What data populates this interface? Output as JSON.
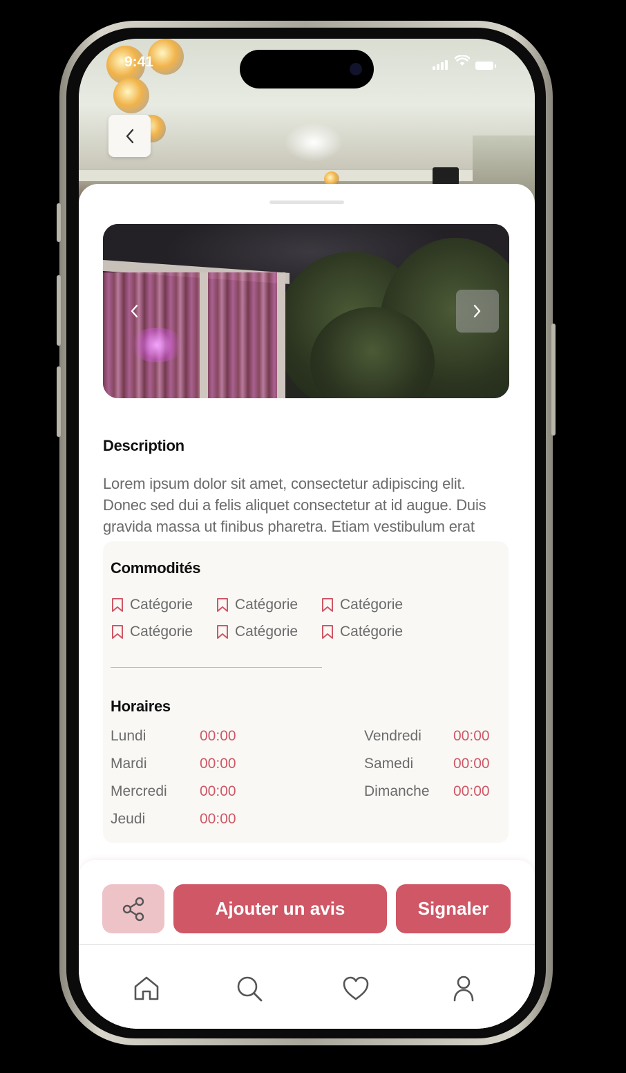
{
  "status_bar": {
    "time": "9:41"
  },
  "description": {
    "title": "Description",
    "text": "Lorem ipsum dolor sit amet, consectetur adipiscing elit. Donec sed dui a felis aliquet consectetur at id augue. Duis gravida massa ut finibus pharetra. Etiam vestibulum erat"
  },
  "amenities": {
    "title": "Commodités",
    "items": [
      "Catégorie",
      "Catégorie",
      "Catégorie",
      "Catégorie",
      "Catégorie",
      "Catégorie"
    ]
  },
  "hours": {
    "title": "Horaires",
    "left": [
      {
        "day": "Lundi",
        "time": "00:00"
      },
      {
        "day": "Mardi",
        "time": "00:00"
      },
      {
        "day": "Mercredi",
        "time": "00:00"
      },
      {
        "day": "Jeudi",
        "time": "00:00"
      }
    ],
    "right": [
      {
        "day": "Vendredi",
        "time": "00:00"
      },
      {
        "day": "Samedi",
        "time": "00:00"
      },
      {
        "day": "Dimanche",
        "time": "00:00"
      }
    ]
  },
  "actions": {
    "share_icon": "share-icon",
    "review_label": "Ajouter un avis",
    "report_label": "Signaler"
  },
  "tabs": [
    {
      "icon": "home-icon"
    },
    {
      "icon": "search-icon"
    },
    {
      "icon": "heart-icon"
    },
    {
      "icon": "user-icon"
    }
  ],
  "colors": {
    "accent": "#cf5766",
    "accent_light": "#eec3c8",
    "card_bg": "#faf8f5",
    "text_muted": "#6b6b6b"
  }
}
